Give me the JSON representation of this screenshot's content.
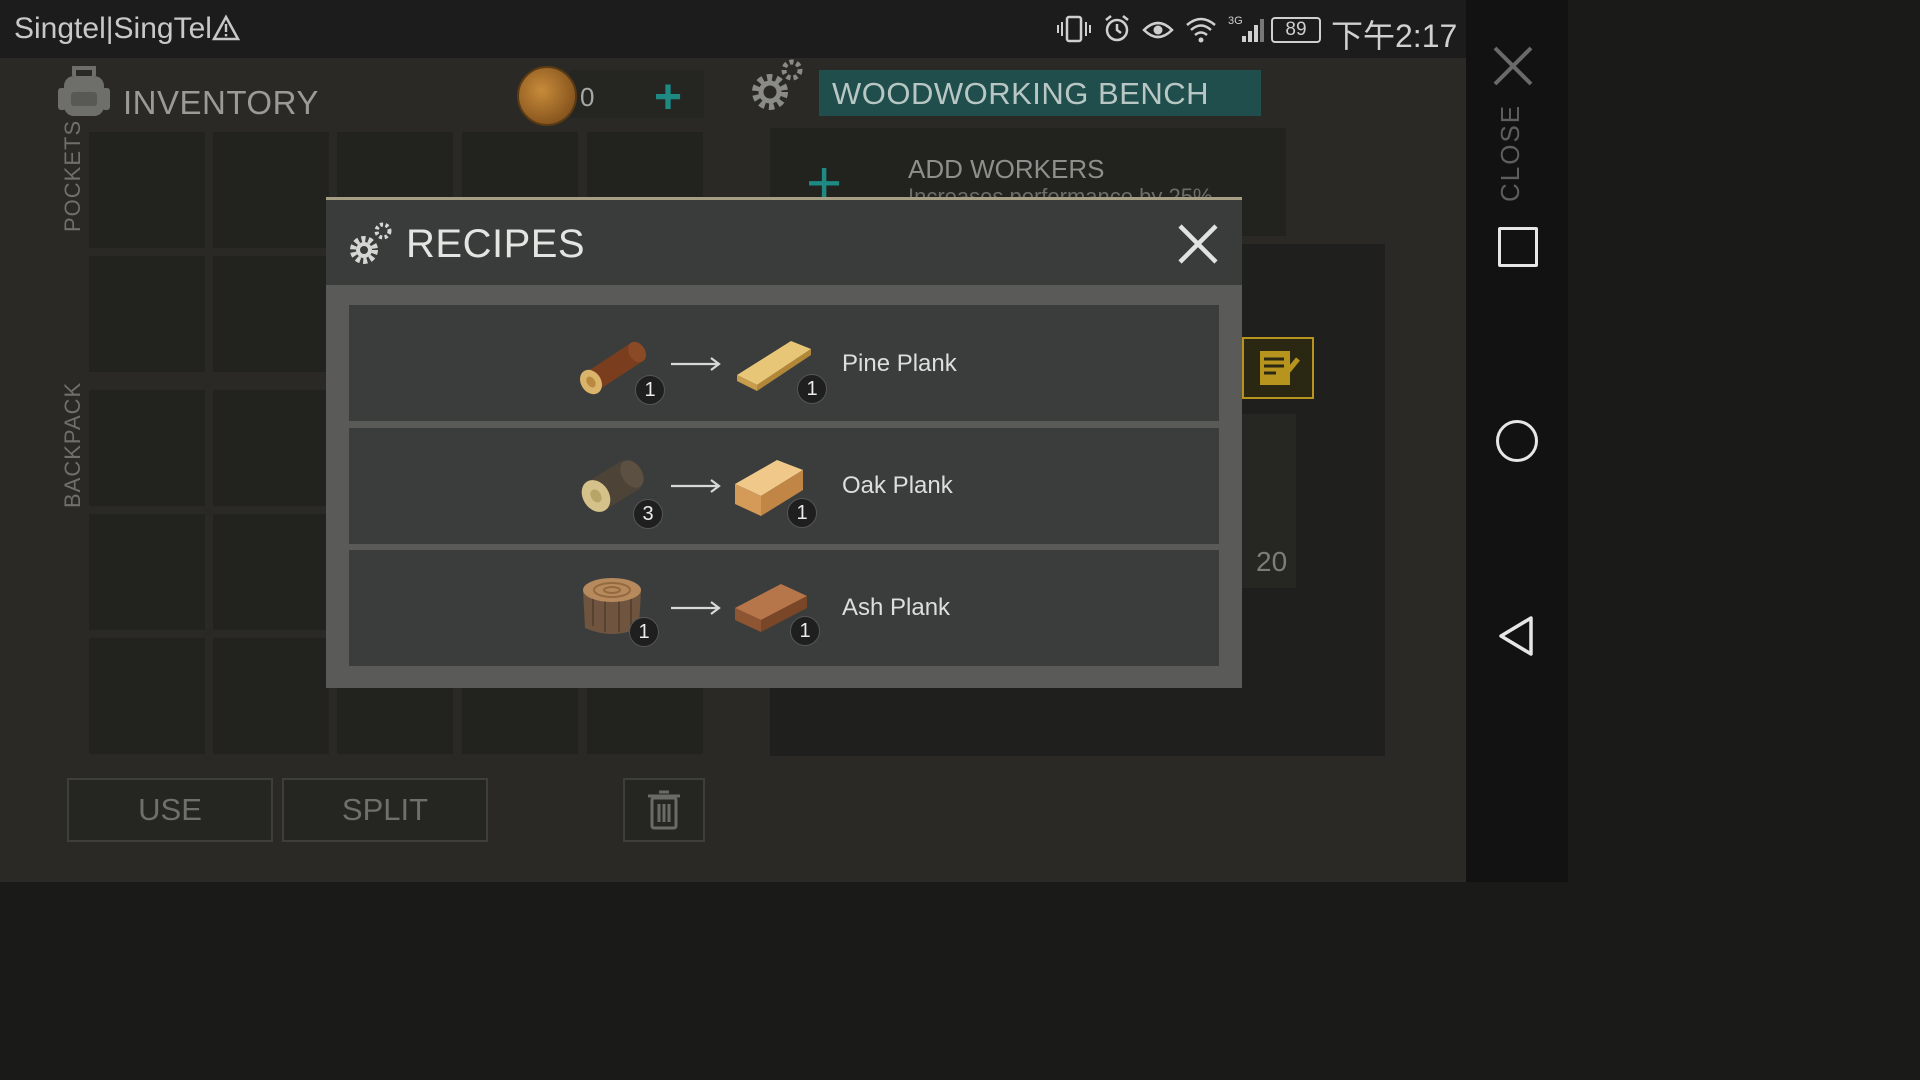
{
  "status_bar": {
    "carrier": "Singtel|SingTel",
    "battery": "89",
    "clock": "下午2:17",
    "network": "3G"
  },
  "inventory": {
    "title": "INVENTORY",
    "coins": "0",
    "pockets_label": "POCKETS",
    "backpack_label": "BACKPACK",
    "use_label": "USE",
    "split_label": "SPLIT"
  },
  "bench": {
    "title": "WOODWORKING BENCH",
    "workers_title": "ADD WORKERS",
    "workers_sub": "Increases performance by 25%",
    "slot_count": "20"
  },
  "nav": {
    "close_label": "CLOSE"
  },
  "modal": {
    "title": "RECIPES",
    "recipes": [
      {
        "name": "Pine Plank",
        "input_qty": "1",
        "output_qty": "1",
        "input_icon": "pine-log-icon",
        "output_icon": "pine-plank-icon"
      },
      {
        "name": "Oak Plank",
        "input_qty": "3",
        "output_qty": "1",
        "input_icon": "oak-log-icon",
        "output_icon": "oak-plank-icon"
      },
      {
        "name": "Ash Plank",
        "input_qty": "1",
        "output_qty": "1",
        "input_icon": "ash-stump-icon",
        "output_icon": "ash-plank-icon"
      }
    ]
  },
  "colors": {
    "accent_teal": "#1f8a84",
    "bench_title_bg": "#1f4e4c",
    "modal_bg": "#5a5b59",
    "recipe_row": "#3b3d3c"
  }
}
